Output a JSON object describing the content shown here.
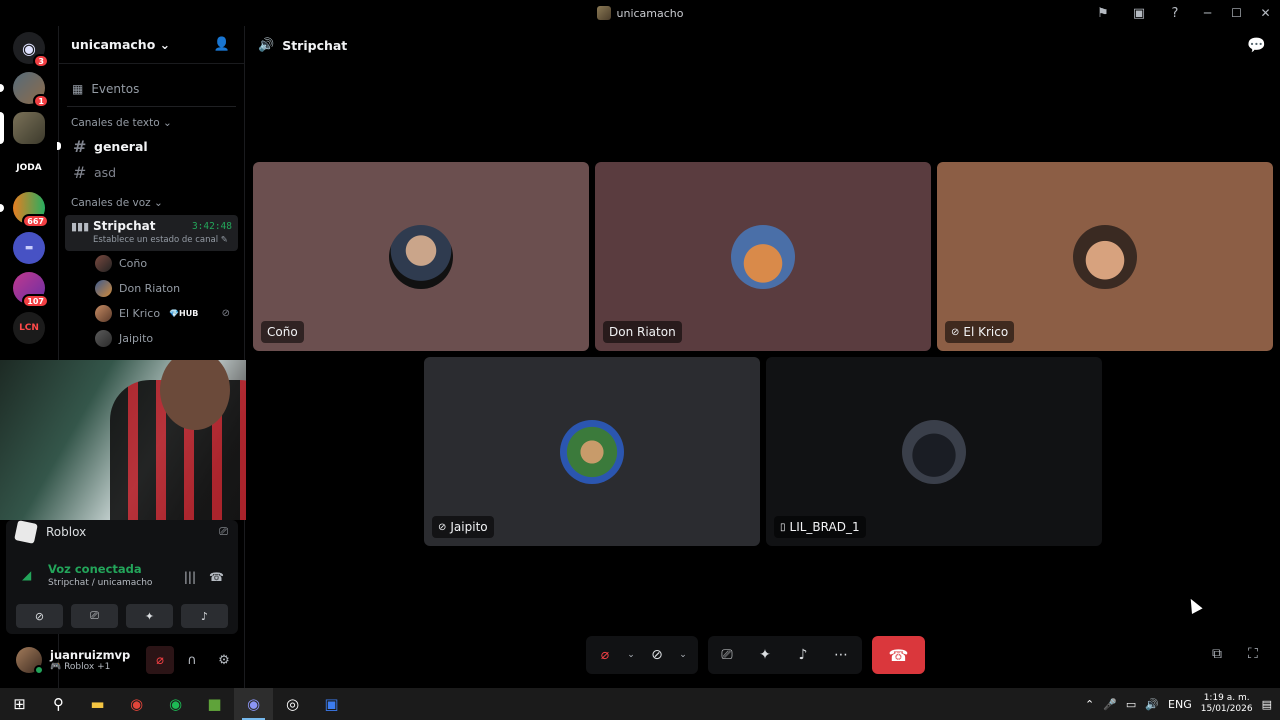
{
  "window": {
    "title": "unicamacho"
  },
  "guilds": [
    {
      "name": "discord-home",
      "badge": "3"
    },
    {
      "name": "server-1",
      "badge": "1"
    },
    {
      "name": "server-2",
      "badge": ""
    },
    {
      "name": "server-3",
      "label": "JODA",
      "badge": ""
    },
    {
      "name": "server-4",
      "badge": "667"
    },
    {
      "name": "server-5",
      "badge": ""
    },
    {
      "name": "server-6",
      "badge": "107"
    },
    {
      "name": "server-7",
      "label": "LCN",
      "badge": ""
    }
  ],
  "sidebar": {
    "server_name": "unicamacho",
    "events_label": "Eventos",
    "text_category": "Canales de texto",
    "text_channels": [
      "general",
      "asd"
    ],
    "voice_category": "Canales de voz",
    "voice_channel": {
      "name": "Stripchat",
      "timer": "3:42:48",
      "status": "Establece un estado de canal"
    },
    "voice_users": [
      "Coño",
      "Don Riaton",
      "El Krico",
      "Jaipito"
    ],
    "hub_tag": "HUB"
  },
  "activity": {
    "game": "Roblox",
    "voice_status": "Voz conectada",
    "voice_location": "Stripchat / unicamacho"
  },
  "user": {
    "name": "juanruizmvp",
    "status": "Roblox +1"
  },
  "main": {
    "channel_name": "Stripchat",
    "tiles": [
      {
        "name": "Coño",
        "bg": "#6b4f4f",
        "icon": ""
      },
      {
        "name": "Don Riaton",
        "bg": "#5a3c3f",
        "icon": ""
      },
      {
        "name": "El Krico",
        "bg": "#8c5e45",
        "icon": "✎"
      },
      {
        "name": "Jaipito",
        "bg": "#2b2c30",
        "icon": "✎"
      },
      {
        "name": "LIL_BRAD_1",
        "bg": "#111214",
        "icon": "▯"
      }
    ]
  },
  "taskbar": {
    "lang": "ENG",
    "time": "1:19 a. m.",
    "date": "15/01/2026"
  }
}
